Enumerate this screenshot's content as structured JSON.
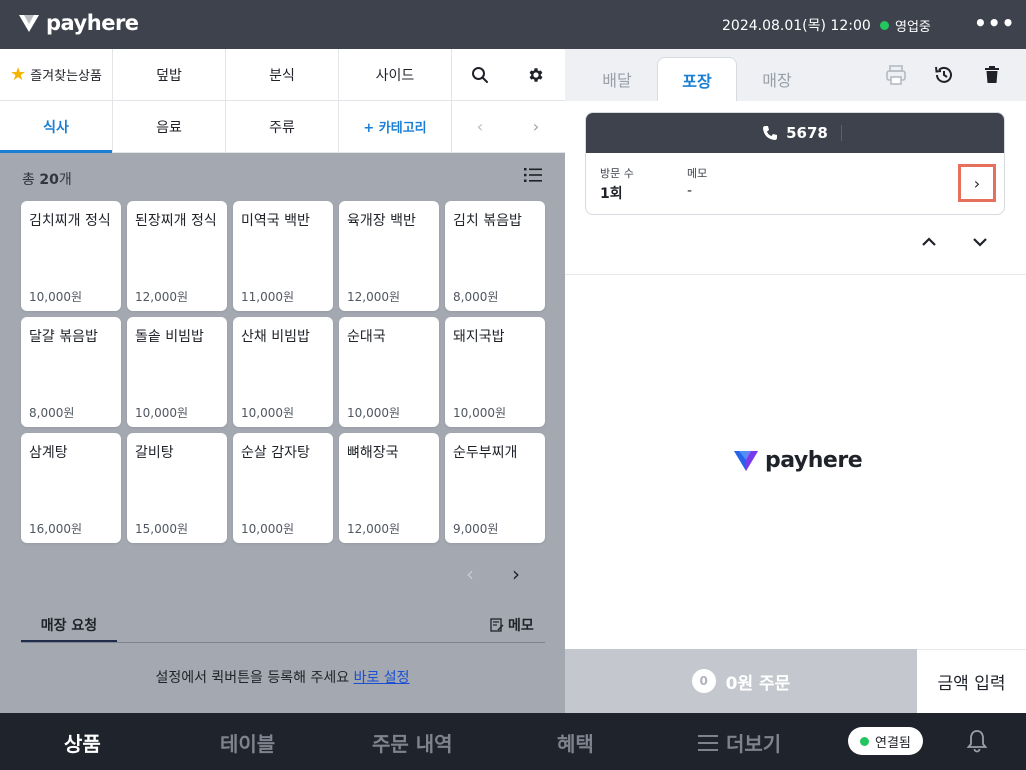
{
  "topbar": {
    "brand": "payhere",
    "datetime": "2024.08.01(목) 12:00",
    "store_status": "영업중",
    "more": "•••"
  },
  "categories": {
    "favorites": "즐겨찾는상품",
    "row1": [
      "덮밥",
      "분식",
      "사이드"
    ],
    "row2": [
      "식사",
      "음료",
      "주류"
    ],
    "add_category": "+ 카테고리",
    "active": "식사"
  },
  "products": {
    "total_prefix": "총 ",
    "total_count": "20",
    "total_suffix": "개",
    "items": [
      {
        "name": "김치찌개 정식",
        "price": "10,000원"
      },
      {
        "name": "된장찌개 정식",
        "price": "12,000원"
      },
      {
        "name": "미역국 백반",
        "price": "11,000원"
      },
      {
        "name": "육개장 백반",
        "price": "12,000원"
      },
      {
        "name": "김치 볶음밥",
        "price": "8,000원"
      },
      {
        "name": "달걀 볶음밥",
        "price": "8,000원"
      },
      {
        "name": "돌솥 비빔밥",
        "price": "10,000원"
      },
      {
        "name": "산채 비빔밥",
        "price": "10,000원"
      },
      {
        "name": "순대국",
        "price": "10,000원"
      },
      {
        "name": "돼지국밥",
        "price": "10,000원"
      },
      {
        "name": "삼계탕",
        "price": "16,000원"
      },
      {
        "name": "갈비탕",
        "price": "15,000원"
      },
      {
        "name": "순살 감자탕",
        "price": "10,000원"
      },
      {
        "name": "뼈해장국",
        "price": "12,000원"
      },
      {
        "name": "순두부찌개",
        "price": "9,000원"
      }
    ]
  },
  "request": {
    "tab": "매장 요청",
    "memo": "메모",
    "hint": "설정에서 퀵버튼을 등록해 주세요",
    "link": "바로 설정"
  },
  "order_tabs": [
    "배달",
    "포장",
    "매장"
  ],
  "order_tabs_active": "포장",
  "customer": {
    "phone": "5678",
    "visits_label": "방문 수",
    "visits_value": "1회",
    "memo_label": "메모",
    "memo_value": "-"
  },
  "empty_brand": "payhere",
  "order": {
    "count": "0",
    "button": "0원 주문",
    "amount_input": "금액 입력"
  },
  "bottom_nav": {
    "items": [
      "상품",
      "테이블",
      "주문 내역",
      "혜택",
      "더보기"
    ],
    "active": "상품",
    "connection": "연결됨"
  },
  "colors": {
    "accent": "#1a7fd4",
    "topbar": "#3d424c",
    "status_green": "#22c55e",
    "highlight": "#e7705c"
  }
}
